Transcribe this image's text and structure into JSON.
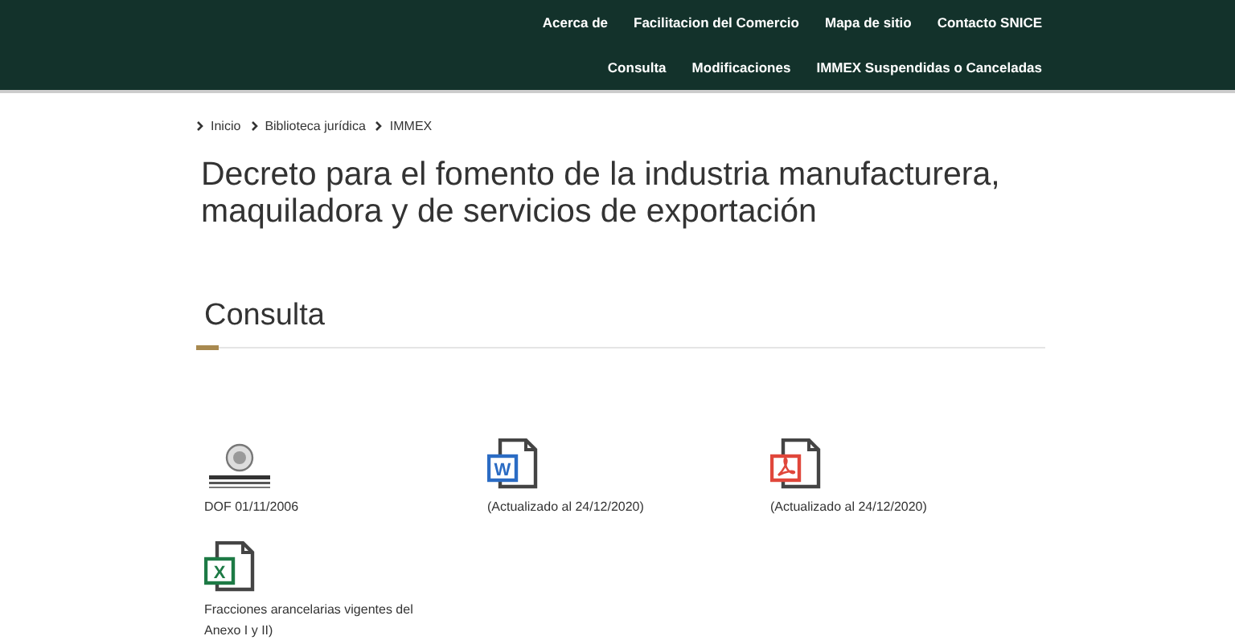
{
  "header": {
    "nav_primary": [
      "Acerca de",
      "Facilitacion del Comercio",
      "Mapa de sitio",
      "Contacto SNICE"
    ],
    "nav_secondary": [
      "Consulta",
      "Modificaciones",
      "IMMEX Suspendidas o Canceladas"
    ]
  },
  "breadcrumb": [
    "Inicio",
    "Biblioteca jurídica",
    "IMMEX"
  ],
  "title": "Decreto para el fomento de la industria manufacturera, maquiladora y de servicios de exportación",
  "section": {
    "heading": "Consulta",
    "files": [
      {
        "kind": "dof",
        "label": "DOF 01/11/2006"
      },
      {
        "kind": "word",
        "glyph": "W",
        "label": "(Actualizado al 24/12/2020)"
      },
      {
        "kind": "pdf",
        "label": "(Actualizado al 24/12/2020)"
      },
      {
        "kind": "excel",
        "glyph": "X",
        "label": "Fracciones arancelarias vigentes del Anexo I y II)"
      }
    ]
  }
}
